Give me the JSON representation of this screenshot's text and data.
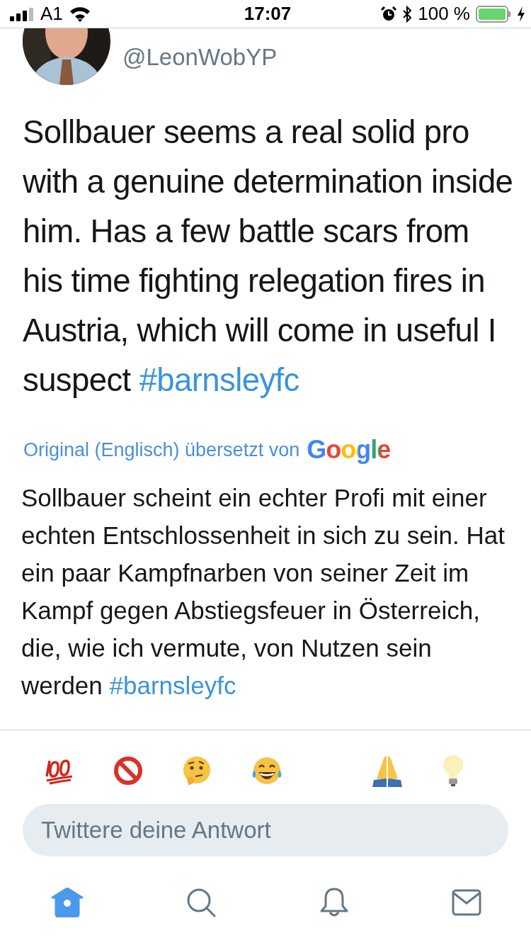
{
  "status_bar": {
    "carrier": "A1",
    "time": "17:07",
    "battery": "100 %"
  },
  "author": {
    "handle": "@LeonWobYP"
  },
  "tweet": {
    "text": "Sollbauer seems a real solid pro with a genuine determination inside him. Has a few battle scars from his time fighting relegation fires in Austria, which will come in useful I suspect ",
    "hashtag": "#barnsleyfc"
  },
  "translation": {
    "label": "Original (Englisch) übersetzt von",
    "provider": "Google",
    "text": "Sollbauer scheint ein echter Profi mit einer echten Entschlossenheit in sich zu sein. Hat ein paar Kampfnarben von seiner Zeit im Kampf gegen Abstiegsfeuer in Österreich, die, wie ich vermute, von Nutzen sein werden ",
    "hashtag": "#barnsleyfc"
  },
  "reply": {
    "placeholder": "Twittere deine Antwort"
  },
  "tabs": [
    {
      "kind": "home",
      "selected": true
    },
    {
      "kind": "search",
      "selected": false
    },
    {
      "kind": "notifications",
      "selected": false
    },
    {
      "kind": "messages",
      "selected": false
    }
  ]
}
